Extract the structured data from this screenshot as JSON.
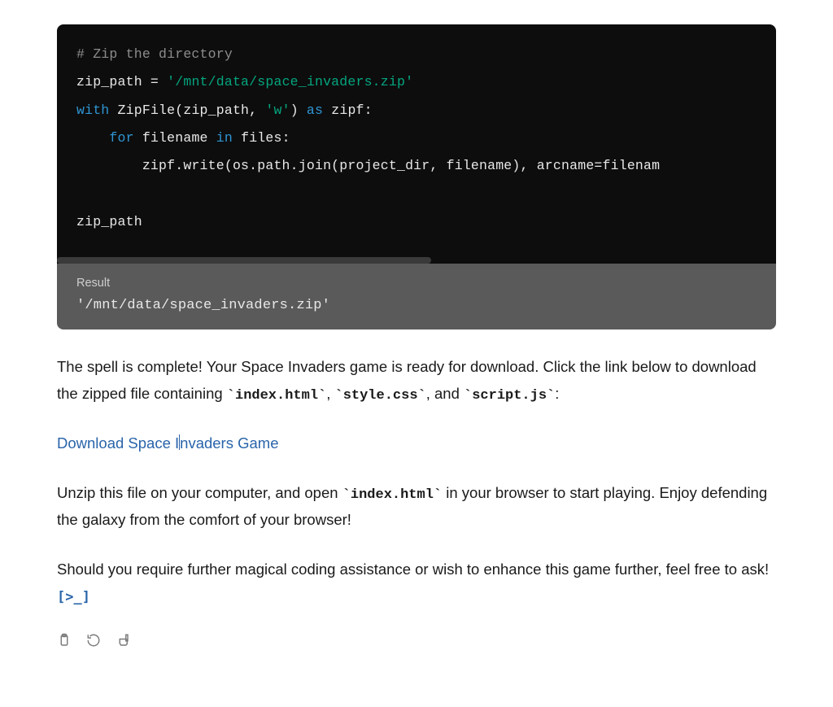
{
  "code_block": {
    "tokens": [
      [
        [
          "comment",
          "# Zip the directory"
        ]
      ],
      [
        [
          "ident",
          "zip_path"
        ],
        [
          "op",
          " = "
        ],
        [
          "string",
          "'/mnt/data/space_invaders.zip'"
        ]
      ],
      [
        [
          "keyword",
          "with"
        ],
        [
          "op",
          " "
        ],
        [
          "ident",
          "ZipFile(zip_path, "
        ],
        [
          "string",
          "'w'"
        ],
        [
          "ident",
          ") "
        ],
        [
          "keyword",
          "as"
        ],
        [
          "op",
          " "
        ],
        [
          "ident",
          "zipf:"
        ]
      ],
      [
        [
          "op",
          "    "
        ],
        [
          "keyword",
          "for"
        ],
        [
          "op",
          " "
        ],
        [
          "ident",
          "filename "
        ],
        [
          "keyword",
          "in"
        ],
        [
          "op",
          " "
        ],
        [
          "ident",
          "files:"
        ]
      ],
      [
        [
          "op",
          "        "
        ],
        [
          "ident",
          "zipf.write(os.path.join(project_dir, filename), arcname=filenam"
        ]
      ],
      [],
      [
        [
          "ident",
          "zip_path"
        ]
      ]
    ]
  },
  "result": {
    "label": "Result",
    "output": "'/mnt/data/space_invaders.zip'"
  },
  "prose": {
    "p1_a": "The spell is complete! Your Space Invaders game is ready for download. Click the link below to download the zipped file containing ",
    "c1": "`index.html`",
    "p1_b": ", ",
    "c2": "`style.css`",
    "p1_c": ", and ",
    "c3": "`script.js`",
    "p1_d": ":",
    "link_a": "Download Space ",
    "link_b": "nvaders Game",
    "p2_a": "Unzip this file on your computer, and open ",
    "c4": "`index.html`",
    "p2_b": " in your browser to start playing. Enjoy defending the galaxy from the comfort of your browser!",
    "p3": "Should you require further magical coding assistance or wish to enhance this game further, feel free to ask! ",
    "prompt_glyph": "[>_]"
  }
}
